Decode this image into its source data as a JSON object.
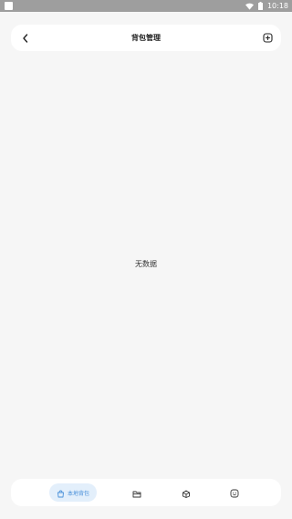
{
  "status_bar": {
    "time": "10:18",
    "icons": [
      "wifi-icon",
      "battery-icon"
    ]
  },
  "header": {
    "title": "背包管理",
    "back_icon": "chevron-left-icon",
    "action_icon": "add-box-icon"
  },
  "main": {
    "empty_text": "无数据"
  },
  "bottom_nav": {
    "items": [
      {
        "label": "本地背包",
        "icon": "bag-icon",
        "active": true
      },
      {
        "label": "",
        "icon": "folder-icon",
        "active": false
      },
      {
        "label": "",
        "icon": "box-icon",
        "active": false
      },
      {
        "label": "",
        "icon": "smile-icon",
        "active": false
      }
    ]
  },
  "colors": {
    "background": "#f6f6f6",
    "card": "#ffffff",
    "accent": "#4a90d9",
    "accent_bg": "#e3effb",
    "status_bar": "#9e9e9e"
  }
}
